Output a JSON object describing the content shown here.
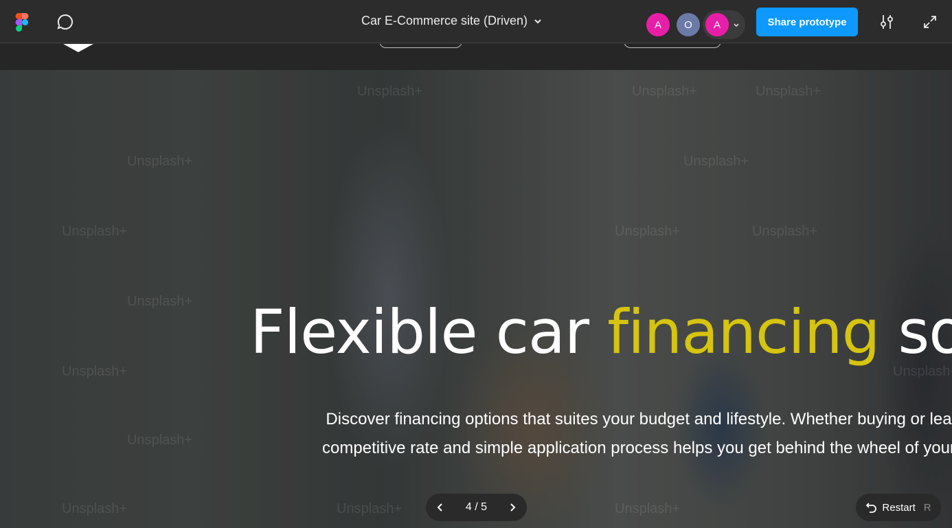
{
  "toolbar": {
    "file_title": "Car E-Commerce site (Driven)",
    "avatars": [
      {
        "initial": "A",
        "color": "#e91ea8"
      },
      {
        "initial": "O",
        "color": "#6b7aa6"
      },
      {
        "initial": "A",
        "color": "#e91ea8"
      }
    ],
    "share_label": "Share prototype",
    "icons": [
      "figma-logo-icon",
      "comment-icon",
      "chevron-down-icon",
      "settings-sliders-icon",
      "expand-icon"
    ]
  },
  "hero": {
    "title_part1": "Flexible car ",
    "title_highlight": "financing",
    "title_part2": " solu",
    "description_line1": "Discover financing options that suites your budget and lifestyle. Whether buying or lea",
    "description_line2": "competitive rate and simple application process helps you get behind the wheel of your",
    "watermark": "Unsplash+",
    "highlight_color": "#d6c40e"
  },
  "controls": {
    "pager_text": "4 / 5",
    "restart_label": "Restart",
    "restart_key": "R"
  },
  "colors": {
    "accent": "#0d99ff",
    "toolbar_bg": "#2c2c2c"
  }
}
